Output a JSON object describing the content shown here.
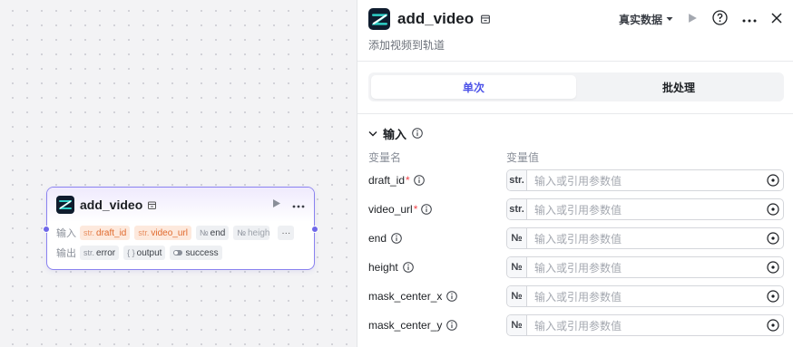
{
  "node": {
    "title": "add_video",
    "input_label": "输入",
    "output_label": "输出",
    "inputs": [
      {
        "type": "str.",
        "name": "draft_id"
      },
      {
        "type": "str.",
        "name": "video_url"
      },
      {
        "type": "№",
        "name": "end"
      },
      {
        "type": "№",
        "name": "heigh"
      }
    ],
    "outputs": [
      {
        "type": "str.",
        "name": "error"
      },
      {
        "type": "{ }",
        "name": "output"
      },
      {
        "type": "",
        "name": "success"
      }
    ],
    "more": "···"
  },
  "panel": {
    "title": "add_video",
    "subtitle": "添加视频到轨道",
    "mode": "真实数据",
    "tabs": [
      {
        "label": "单次",
        "active": true
      },
      {
        "label": "批处理",
        "active": false
      }
    ],
    "section": "输入",
    "col_name": "变量名",
    "col_value": "变量值",
    "placeholder": "输入或引用参数值",
    "params": [
      {
        "name": "draft_id",
        "required": "*",
        "type": "str."
      },
      {
        "name": "video_url",
        "required": "*",
        "type": "str."
      },
      {
        "name": "end",
        "required": "",
        "type": "№"
      },
      {
        "name": "height",
        "required": "",
        "type": "№"
      },
      {
        "name": "mask_center_x",
        "required": "",
        "type": "№"
      },
      {
        "name": "mask_center_y",
        "required": "",
        "type": "№"
      }
    ]
  },
  "colors": {
    "accent": "#4d53e8",
    "node_border": "#8a82f0",
    "tag_orange": "#e06a2e",
    "required": "#f0454b"
  }
}
